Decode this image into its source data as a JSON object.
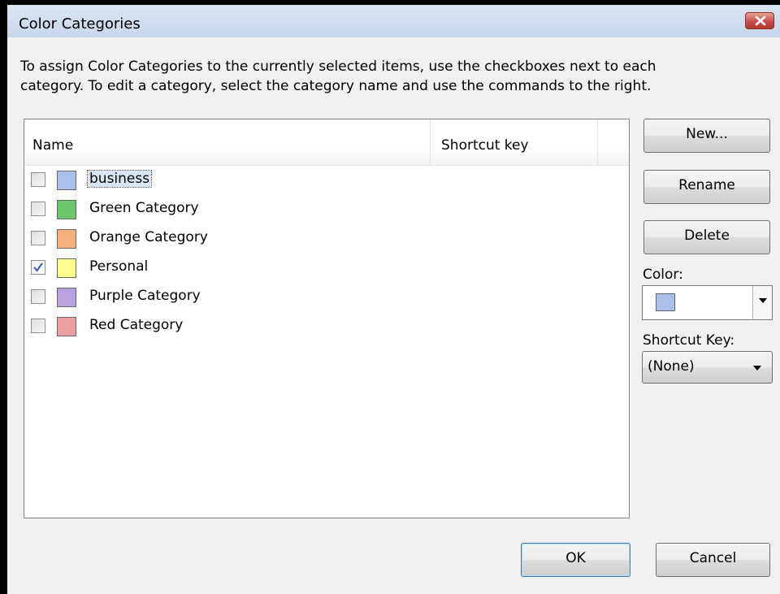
{
  "dialog": {
    "title": "Color Categories",
    "close_icon": "close-icon",
    "intro_lines": [
      "To assign Color Categories to the currently selected items, use the checkboxes next to each",
      "category.  To edit a category, select the category name and use the commands to the right."
    ]
  },
  "list": {
    "columns": [
      "Name",
      "Shortcut key"
    ],
    "rows": [
      {
        "label": "business",
        "color": "#a9c1ea",
        "checked": false,
        "selected": true
      },
      {
        "label": "Green Category",
        "color": "#6cc66c",
        "checked": false,
        "selected": false
      },
      {
        "label": "Orange Category",
        "color": "#f6b07c",
        "checked": false,
        "selected": false
      },
      {
        "label": "Personal",
        "color": "#fdfd8f",
        "checked": true,
        "selected": false
      },
      {
        "label": "Purple Category",
        "color": "#b9a3e0",
        "checked": false,
        "selected": false
      },
      {
        "label": "Red Category",
        "color": "#eca0a0",
        "checked": false,
        "selected": false
      }
    ]
  },
  "side": {
    "new_label": "New...",
    "rename_label": "Rename",
    "delete_label": "Delete",
    "color_label": "Color:",
    "color_value": "#a9c1ea",
    "shortcut_label": "Shortcut Key:",
    "shortcut_value": "(None)"
  },
  "footer": {
    "ok_label": "OK",
    "cancel_label": "Cancel"
  }
}
